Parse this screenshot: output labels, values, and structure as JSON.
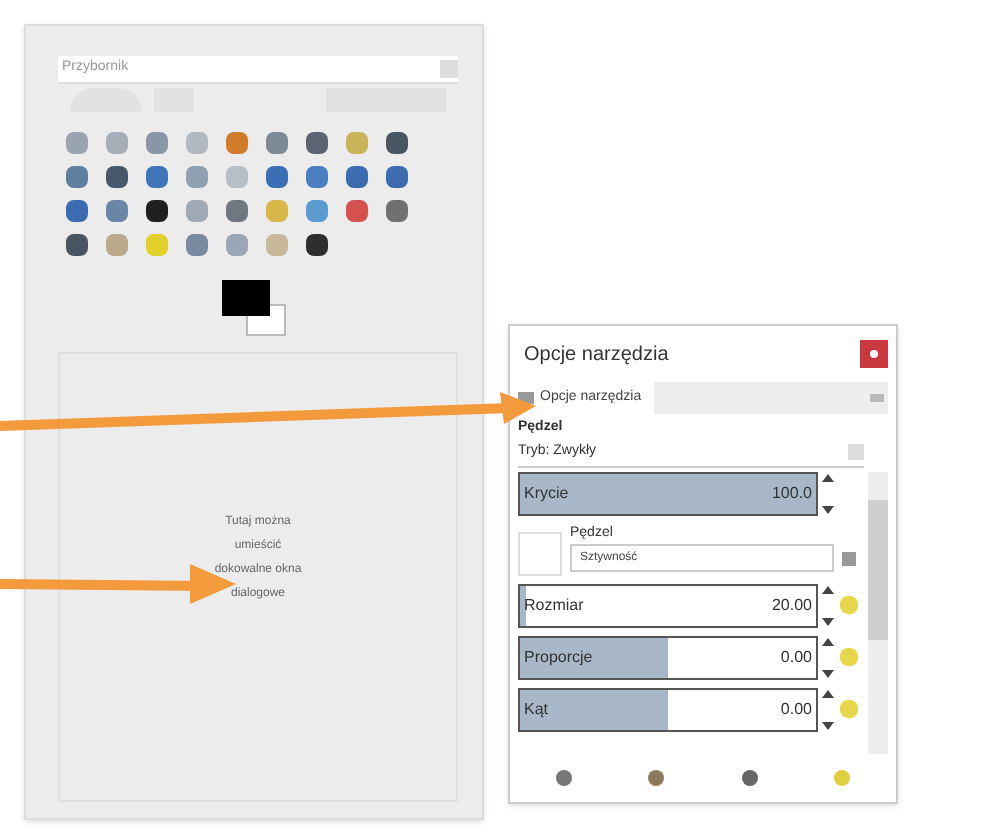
{
  "toolbox": {
    "title": "Przybornik",
    "dock_hint": "Tutaj można umieścić dokowalne okna dialogowe"
  },
  "tool_options": {
    "title": "Opcje narzędzia",
    "tab": "Opcje narzędzia",
    "section": "Pędzel",
    "mode": "Tryb: Zwykły",
    "controls": [
      {
        "kind": "slider",
        "label": "Krycie",
        "reading": "100.0",
        "level": 1.0
      },
      {
        "kind": "brush",
        "label": "Pędzel",
        "value": "Sztywność"
      },
      {
        "kind": "slider",
        "label": "Rozmiar",
        "reading": "20.00",
        "level": 0.02
      },
      {
        "kind": "slider",
        "label": "Proporcje",
        "reading": "0.00",
        "level": 0.5
      },
      {
        "kind": "slider",
        "label": "Kąt",
        "reading": "0.00",
        "level": 0.5
      }
    ]
  }
}
